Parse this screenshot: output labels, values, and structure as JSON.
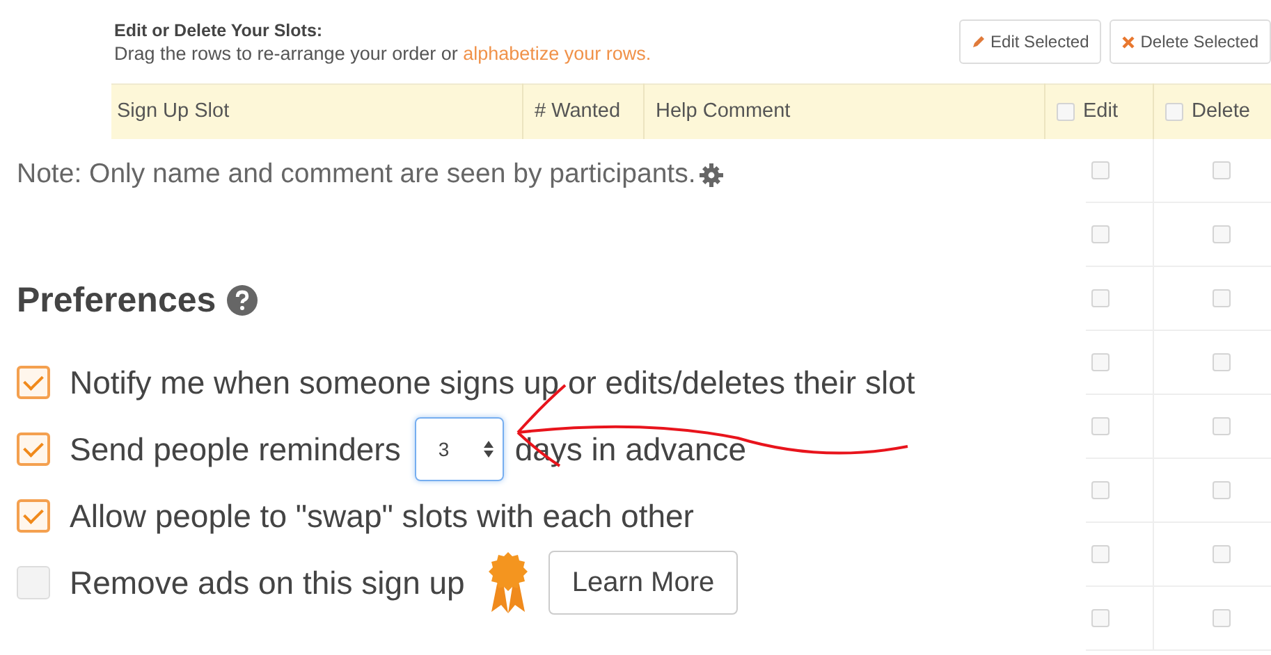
{
  "header": {
    "title": "Edit or Delete Your Slots:",
    "instruction": "Drag the rows to re-arrange your order or ",
    "instruction_link": "alphabetize your rows.",
    "buttons": [
      {
        "label": "Edit Selected"
      },
      {
        "label": "Delete Selected"
      }
    ]
  },
  "table": {
    "columns": [
      {
        "kind": "text",
        "label": "Sign Up Slot"
      },
      {
        "kind": "text",
        "label": "# Wanted"
      },
      {
        "kind": "text",
        "label": "Help Comment"
      },
      {
        "kind": "check",
        "label": "Edit",
        "checked": false
      },
      {
        "kind": "check",
        "label": "Delete",
        "checked": false
      }
    ],
    "rows": [
      {
        "edit": false,
        "delete": false
      },
      {
        "edit": false,
        "delete": false
      },
      {
        "edit": false,
        "delete": false
      },
      {
        "edit": false,
        "delete": false
      },
      {
        "edit": false,
        "delete": false
      },
      {
        "edit": false,
        "delete": false
      },
      {
        "edit": false,
        "delete": false
      },
      {
        "edit": false,
        "delete": false
      }
    ]
  },
  "panel": {
    "note": "Note: Only name and comment are seen by participants.",
    "preferences": {
      "title": "Preferences",
      "options": [
        {
          "kind": "check",
          "label": "Notify me when someone signs up or edits/deletes their slot",
          "checked": true
        },
        {
          "kind": "days",
          "label": "Send people reminders",
          "value": "3",
          "suffix": "days in advance",
          "checked": true
        },
        {
          "kind": "check",
          "label": "Allow people to \"swap\" slots with each other",
          "checked": true
        },
        {
          "kind": "upsell",
          "label": "Remove ads on this sign up",
          "button": "Learn More",
          "checked": false
        }
      ]
    }
  }
}
